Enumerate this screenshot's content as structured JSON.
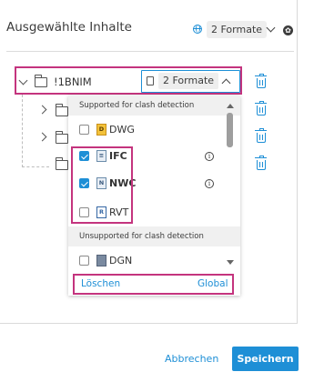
{
  "header": {
    "title": "Ausgewählte Inhalte",
    "formats_pill": "2 Formate"
  },
  "tree": {
    "root_label": "!1BNIM",
    "root_formats_pill": "2 Formate"
  },
  "dropdown": {
    "supported_header": "Supported for clash detection",
    "unsupported_header": "Unsupported for clash detection",
    "supported_items": [
      {
        "label": "DWG",
        "checked": false,
        "icon": "dwg-file-icon",
        "badge": "D",
        "info": false
      },
      {
        "label": "IFC",
        "checked": true,
        "icon": "ifc-file-icon",
        "badge": "",
        "info": true
      },
      {
        "label": "NWC",
        "checked": true,
        "icon": "nwc-file-icon",
        "badge": "N",
        "info": true
      },
      {
        "label": "RVT",
        "checked": false,
        "icon": "rvt-file-icon",
        "badge": "R",
        "info": false
      }
    ],
    "unsupported_items": [
      {
        "label": "DGN",
        "checked": false,
        "icon": "dgn-file-icon",
        "badge": ""
      }
    ],
    "footer": {
      "clear_label": "Löschen",
      "global_label": "Global"
    }
  },
  "actions": {
    "cancel_label": "Abbrechen",
    "save_label": "Speichern"
  },
  "colors": {
    "accent": "#1e8fd6",
    "highlight": "#c4347e"
  }
}
